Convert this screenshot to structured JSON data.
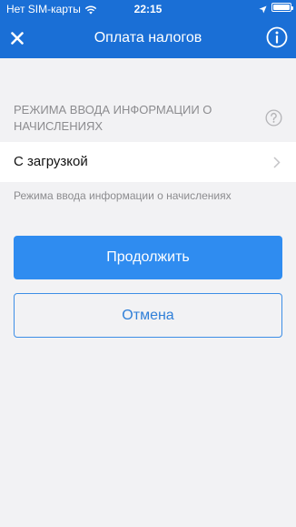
{
  "status_bar": {
    "carrier": "Нет SIM-карты",
    "time": "22:15"
  },
  "nav": {
    "title": "Оплата налогов"
  },
  "section": {
    "label": "РЕЖИМА ВВОДА ИНФОРМАЦИИ О НАЧИСЛЕНИЯХ",
    "selected_value": "С загрузкой",
    "hint": "Режима ввода информации о начислениях"
  },
  "buttons": {
    "continue_label": "Продолжить",
    "cancel_label": "Отмена"
  },
  "colors": {
    "header": "#1a6fd6",
    "primary_button": "#2f8cf0",
    "background": "#f2f2f4"
  },
  "icons": [
    "wifi-icon",
    "location-icon",
    "battery-icon",
    "close-icon",
    "info-icon",
    "help-icon",
    "chevron-right-icon"
  ]
}
